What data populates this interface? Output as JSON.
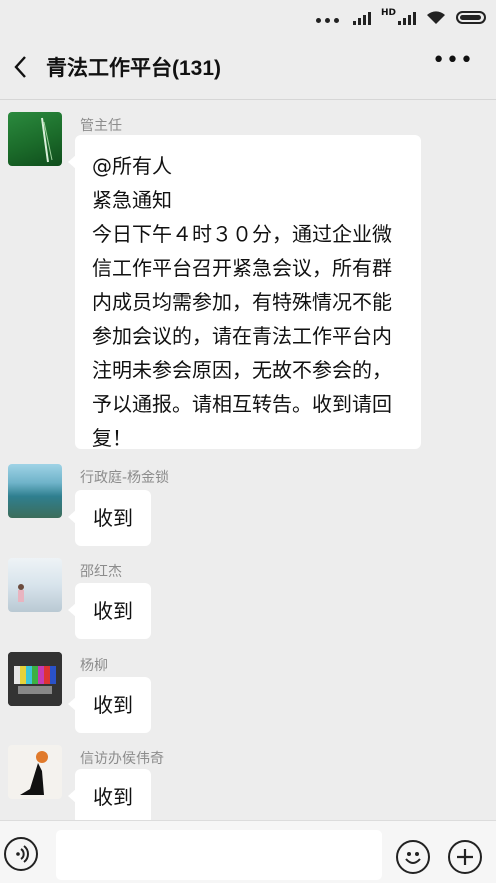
{
  "header": {
    "title": "青法工作平台(131)",
    "more_label": "•••"
  },
  "messages": [
    {
      "sender": "管主任",
      "lines": [
        "@所有人",
        "紧急通知",
        "今日下午４时３０分，通过企业微",
        "信工作平台召开紧急会议，所有群",
        "内成员均需参加，有特殊情况不能",
        "参加会议的，请在青法工作平台内",
        "注明未参会原因，无故不参会的，",
        "予以通报。请相互转告。收到请回",
        "复！"
      ]
    },
    {
      "sender": "行政庭-杨金锁",
      "text": "收到"
    },
    {
      "sender": "邵红杰",
      "text": "收到"
    },
    {
      "sender": "杨柳",
      "text": "收到"
    },
    {
      "sender": "信访办侯伟奇",
      "text": "收到"
    }
  ],
  "icons": {
    "back": "back-arrow-icon",
    "more": "more-dots-icon",
    "voice": "voice-icon",
    "emoji": "emoji-icon",
    "plus": "plus-icon"
  },
  "colors": {
    "background": "#ededed",
    "bubble": "#ffffff",
    "sender": "#8c8c8c"
  }
}
